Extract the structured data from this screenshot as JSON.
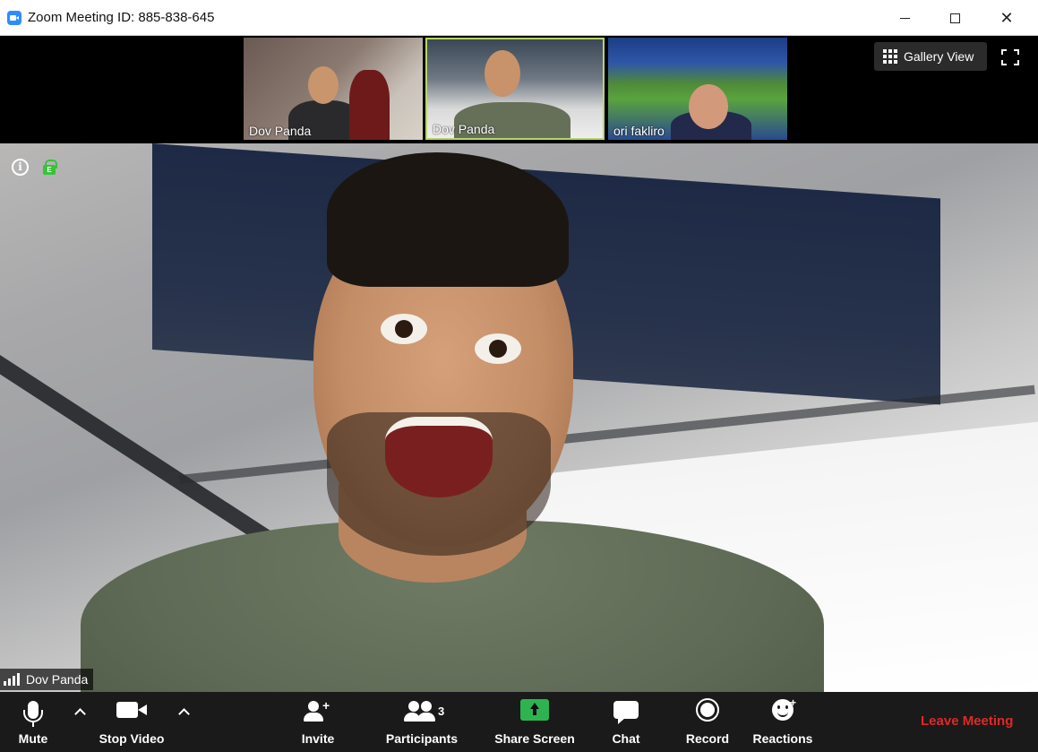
{
  "window": {
    "title": "Zoom Meeting ID: 885-838-645",
    "minimize_icon": "minimize-icon",
    "maximize_icon": "maximize-icon",
    "close_icon": "close-icon"
  },
  "top_strip": {
    "thumbnails": [
      {
        "name": "Dov Panda",
        "active_speaker": false
      },
      {
        "name": "Dov Panda",
        "active_speaker": true
      },
      {
        "name": "ori fakliro",
        "active_speaker": false
      }
    ],
    "gallery_view_label": "Gallery View",
    "fullscreen_icon": "fullscreen-icon"
  },
  "main_video": {
    "speaker_name": "Dov Panda",
    "info_icon": "info-icon",
    "encryption_icon": "lock-icon",
    "encryption_letter": "E"
  },
  "toolbar": {
    "mute_label": "Mute",
    "stop_video_label": "Stop Video",
    "invite_label": "Invite",
    "participants_label": "Participants",
    "participants_count": "3",
    "share_screen_label": "Share Screen",
    "chat_label": "Chat",
    "record_label": "Record",
    "reactions_label": "Reactions",
    "leave_label": "Leave Meeting"
  },
  "colors": {
    "accent_blue": "#2d8cff",
    "share_green": "#2fb350",
    "leave_red": "#e02828",
    "active_border": "#b9d66a",
    "encryption_green": "#38c23a"
  }
}
